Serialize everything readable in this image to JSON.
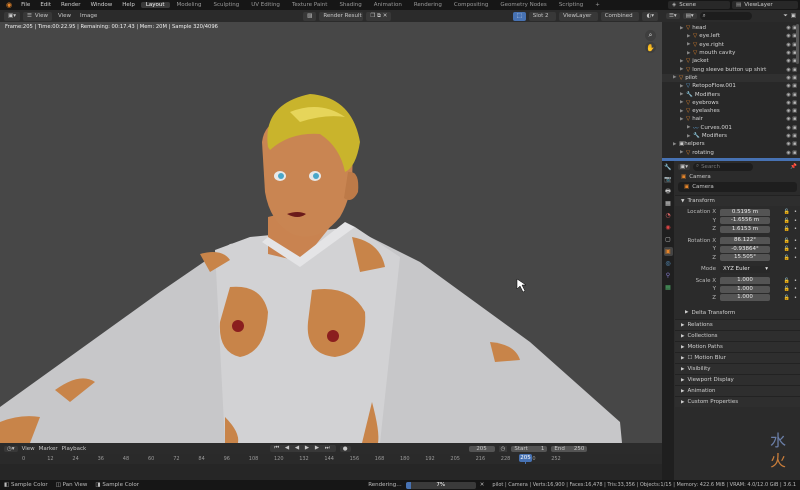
{
  "topbar": {
    "menus": [
      "File",
      "Edit",
      "Render",
      "Window",
      "Help"
    ],
    "workspaces": [
      "Layout",
      "Modeling",
      "Sculpting",
      "UV Editing",
      "Texture Paint",
      "Shading",
      "Animation",
      "Rendering",
      "Compositing",
      "Geometry Nodes",
      "Scripting"
    ],
    "active_workspace": "Layout",
    "add_tab": "+",
    "scene": "Scene",
    "view_layer": "ViewLayer"
  },
  "viewport_header": {
    "view": "View",
    "image": "Image",
    "image_name": "Render Result",
    "slot": "Slot 2",
    "layer": "ViewLayer",
    "pass": "Combined"
  },
  "render_info": "Frame:205 | Time:00:22.95 | Remaining: 00:17.43 | Mem: 20M | Sample 320/4096",
  "timeline": {
    "view": "View",
    "marker": "Marker",
    "playback": "Playback",
    "current_frame": "205",
    "start_label": "Start",
    "start": "1",
    "end_label": "End",
    "end": "250",
    "ruler_numbers": [
      "0",
      "12",
      "24",
      "36",
      "48",
      "60",
      "72",
      "84",
      "96",
      "108",
      "120",
      "132",
      "144",
      "156",
      "168",
      "180",
      "192",
      "205",
      "216",
      "228",
      "240",
      "252"
    ]
  },
  "status_bar": {
    "left": [
      "Sample Color",
      "Pan View",
      "Sample Color"
    ],
    "rendering": "Rendering…",
    "progress_pct": 0.07,
    "progress_label": "7%",
    "right": "pilot | Camera | Verts:16,900 | Faces:16,478 | Tris:33,356 | Objects:1/15 | Memory: 422.6 MiB | VRAM: 4.0/12.0 GiB | 3.6.1"
  },
  "outliner": {
    "search_placeholder": "",
    "rows": [
      {
        "indent": 2,
        "icon": "object",
        "name": "head"
      },
      {
        "indent": 3,
        "icon": "object",
        "name": "eye.left"
      },
      {
        "indent": 3,
        "icon": "object",
        "name": "eye.right"
      },
      {
        "indent": 3,
        "icon": "object",
        "name": "mouth cavity"
      },
      {
        "indent": 2,
        "icon": "object",
        "name": "jacket"
      },
      {
        "indent": 2,
        "icon": "object",
        "name": "long sleeve button up shirt"
      },
      {
        "indent": 1,
        "icon": "object",
        "name": "pilot"
      },
      {
        "indent": 2,
        "icon": "mesh",
        "name": "RetopoFlow.001"
      },
      {
        "indent": 2,
        "icon": "modifier",
        "name": "Modifiers"
      },
      {
        "indent": 2,
        "icon": "object",
        "name": "eyebrows"
      },
      {
        "indent": 2,
        "icon": "object",
        "name": "eyelashes"
      },
      {
        "indent": 2,
        "icon": "object",
        "name": "hair"
      },
      {
        "indent": 3,
        "icon": "curve",
        "name": "Curves.001"
      },
      {
        "indent": 3,
        "icon": "modifier",
        "name": "Modifiers"
      },
      {
        "indent": 1,
        "icon": "collection",
        "name": "helpers"
      },
      {
        "indent": 2,
        "icon": "object",
        "name": "rotating"
      }
    ]
  },
  "properties": {
    "search_placeholder": "Search",
    "object_name": "Camera",
    "data_name": "Camera",
    "transform_header": "Transform",
    "location": [
      {
        "label": "Location X",
        "value": "0.5195 m"
      },
      {
        "label": "Y",
        "value": "-1.6556 m"
      },
      {
        "label": "Z",
        "value": "1.6153 m"
      }
    ],
    "rotation": [
      {
        "label": "Rotation X",
        "value": "86.122°"
      },
      {
        "label": "Y",
        "value": "-0.93864°"
      },
      {
        "label": "Z",
        "value": "15.505°"
      }
    ],
    "mode_label": "Mode",
    "mode": "XYZ Euler",
    "scale": [
      {
        "label": "Scale X",
        "value": "1.000"
      },
      {
        "label": "Y",
        "value": "1.000"
      },
      {
        "label": "Z",
        "value": "1.000"
      }
    ],
    "delta_transform": "Delta Transform",
    "panels": [
      "Relations",
      "Collections",
      "Motion Paths",
      "Motion Blur",
      "Visibility",
      "Viewport Display",
      "Animation",
      "Custom Properties"
    ]
  },
  "colors": {
    "accent": "#4772b3",
    "orange": "#e5852a",
    "bg": "#474747"
  }
}
